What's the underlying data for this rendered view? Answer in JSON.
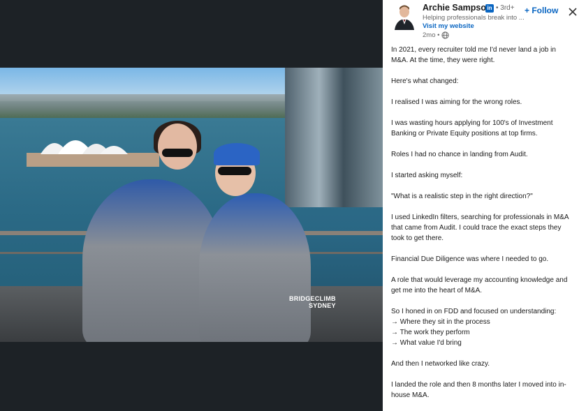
{
  "media": {
    "watermark_line1": "BRIDGECLIMB",
    "watermark_line2": "SYDNEY"
  },
  "author": {
    "name": "Archie Sampson",
    "linkedin_badge": "in",
    "degree": "• 3rd+",
    "headline": "Helping professionals break into ...",
    "website_label": "Visit my website",
    "timestamp": "2mo •",
    "avatar_icon": "profile-photo",
    "globe_icon": "globe-icon"
  },
  "actions": {
    "follow_label": "+ Follow",
    "close_icon": "close-icon"
  },
  "post": {
    "lines": [
      "In 2021, every recruiter told me I'd never land a job in M&A. At the time, they were right.",
      "",
      "Here's what changed:",
      "",
      "I realised I was aiming for the wrong roles.",
      "",
      "I was wasting hours applying for 100's of Investment Banking or Private Equity positions at top firms.",
      "",
      "Roles I had no chance in landing from Audit.",
      "",
      "I started asking myself:",
      "",
      "\"What is a realistic step in the right direction?\"",
      "",
      "I used LinkedIn filters, searching for professionals in M&A that came from Audit. I could trace the exact steps they took to get there.",
      "",
      "Financial Due Diligence was where I needed to go.",
      "",
      "A role that would leverage my accounting knowledge and get me into the heart of M&A.",
      "",
      "So I honed in on FDD and focused on understanding:",
      "→ Where they sit in the process",
      "→ The work they perform",
      "→ What value I'd bring",
      "",
      "And then I networked like crazy.",
      "",
      "I landed the role and then 8 months later I moved into in-house M&A."
    ]
  },
  "colors": {
    "accent": "#0a66c2",
    "text": "#191919",
    "muted": "#666666",
    "media_bg": "#1d2226"
  }
}
